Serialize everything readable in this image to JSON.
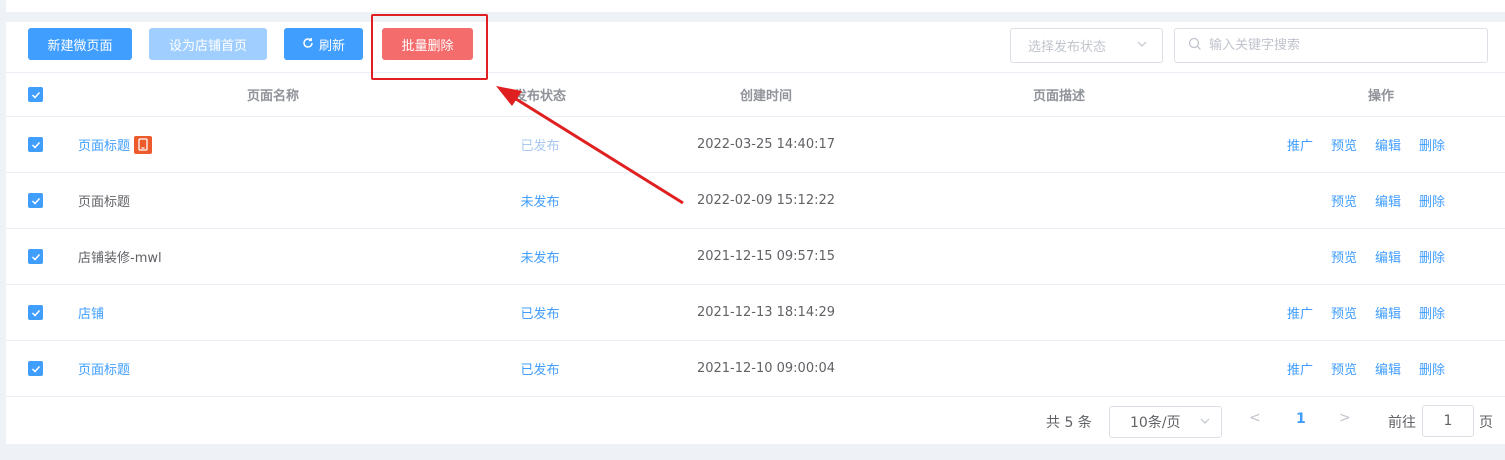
{
  "toolbar": {
    "new_label": "新建微页面",
    "set_home_label": "设为店铺首页",
    "refresh_label": "刷新",
    "batch_delete_label": "批量删除",
    "status_placeholder": "选择发布状态",
    "search_placeholder": "输入关键字搜索"
  },
  "table": {
    "headers": {
      "name": "页面名称",
      "status": "发布状态",
      "time": "创建时间",
      "desc": "页面描述",
      "ops": "操作"
    },
    "rows": [
      {
        "name": "页面标题",
        "status": "已发布",
        "time": "2022-03-25 14:40:17",
        "desc": "",
        "ops": [
          "推广",
          "预览",
          "编辑",
          "删除"
        ]
      },
      {
        "name": "页面标题",
        "status": "未发布",
        "time": "2022-02-09 15:12:22",
        "desc": "",
        "ops": [
          "预览",
          "编辑",
          "删除"
        ]
      },
      {
        "name": "店铺装修-mwl",
        "status": "未发布",
        "time": "2021-12-15 09:57:15",
        "desc": "",
        "ops": [
          "预览",
          "编辑",
          "删除"
        ]
      },
      {
        "name": "店铺",
        "status": "已发布",
        "time": "2021-12-13 18:14:29",
        "desc": "",
        "ops": [
          "推广",
          "预览",
          "编辑",
          "删除"
        ]
      },
      {
        "name": "页面标题",
        "status": "已发布",
        "time": "2021-12-10 09:00:04",
        "desc": "",
        "ops": [
          "推广",
          "预览",
          "编辑",
          "删除"
        ]
      }
    ]
  },
  "pagination": {
    "total": "共 5 条",
    "page_size": "10条/页",
    "prev": "<",
    "current": "1",
    "next": ">",
    "goto_label": "前往",
    "goto_value": "1",
    "goto_unit": "页"
  },
  "icons": {
    "refresh": "refresh-icon",
    "search": "search-icon",
    "badge": "mobile-page-icon",
    "check": "check-icon"
  },
  "colors": {
    "primary": "#409eff",
    "primary_light": "#a0cfff",
    "danger": "#f56c6c",
    "annotation": "#e02020",
    "badge": "#ed5a2c"
  }
}
